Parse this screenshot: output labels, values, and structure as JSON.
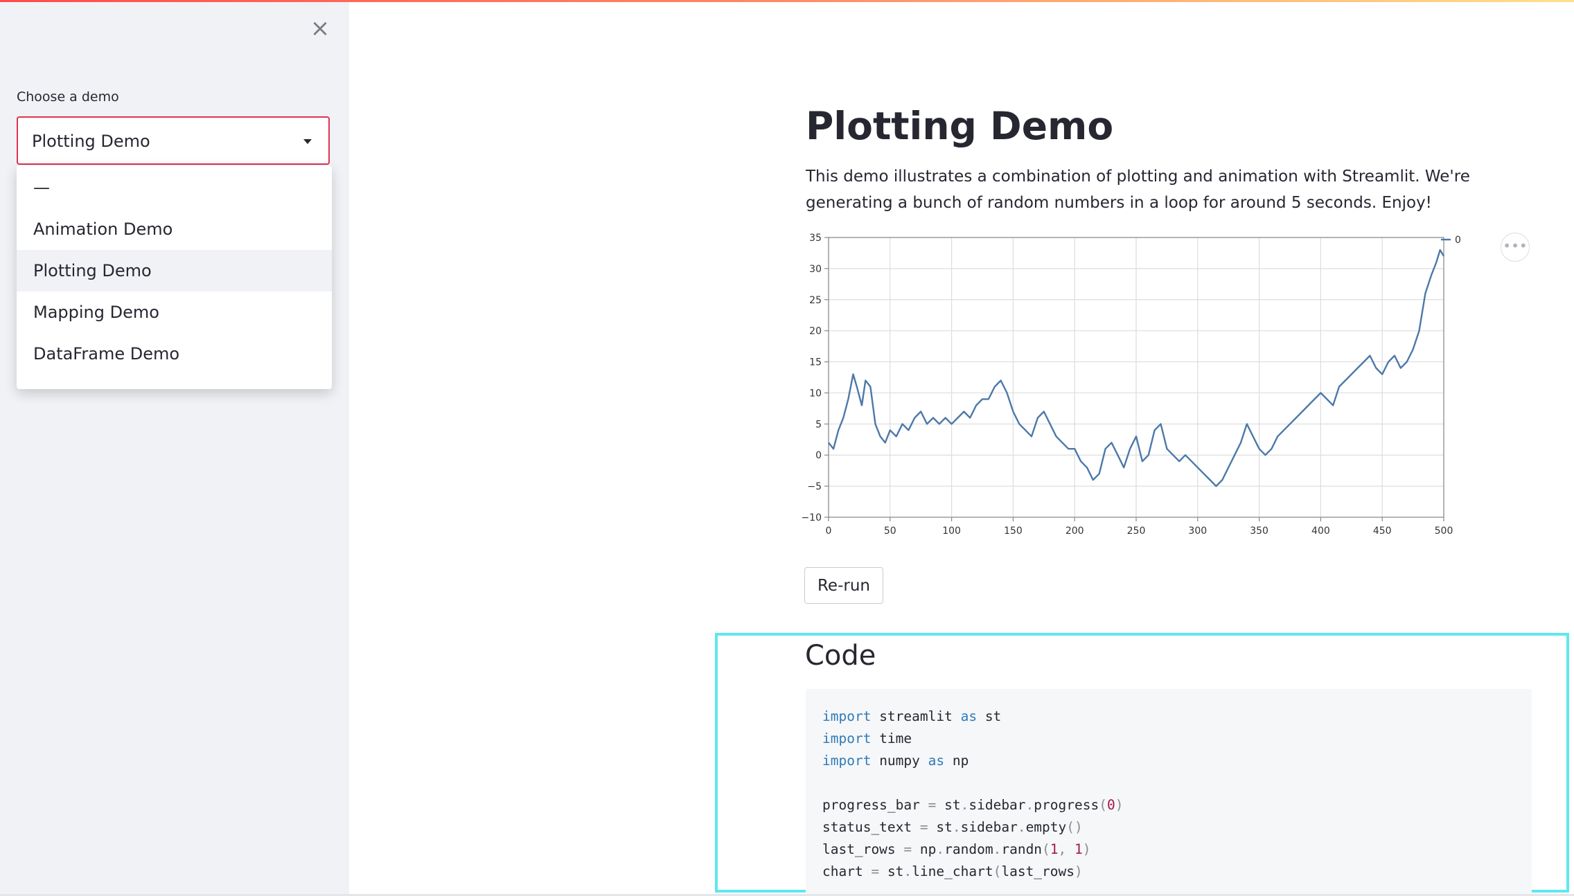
{
  "sidebar": {
    "close_symbol": "×",
    "select_label": "Choose a demo",
    "selected_value": "Plotting Demo",
    "options": [
      "—",
      "Animation Demo",
      "Plotting Demo",
      "Mapping Demo",
      "DataFrame Demo"
    ]
  },
  "main": {
    "title": "Plotting Demo",
    "description": "This demo illustrates a combination of plotting and animation with Streamlit. We're generating a bunch of random numbers in a loop for around 5 seconds. Enjoy!",
    "rerun_label": "Re-run",
    "more_menu_symbol": "•••",
    "code_heading": "Code",
    "code_lines": [
      [
        {
          "t": "import",
          "c": "kw"
        },
        {
          "t": " streamlit "
        },
        {
          "t": "as",
          "c": "kw"
        },
        {
          "t": " st"
        }
      ],
      [
        {
          "t": "import",
          "c": "kw"
        },
        {
          "t": " time"
        }
      ],
      [
        {
          "t": "import",
          "c": "kw"
        },
        {
          "t": " numpy "
        },
        {
          "t": "as",
          "c": "kw"
        },
        {
          "t": " np"
        }
      ],
      [],
      [
        {
          "t": "progress_bar "
        },
        {
          "t": "=",
          "c": "op"
        },
        {
          "t": " st"
        },
        {
          "t": ".",
          "c": "op"
        },
        {
          "t": "sidebar"
        },
        {
          "t": ".",
          "c": "op"
        },
        {
          "t": "progress"
        },
        {
          "t": "(",
          "c": "op"
        },
        {
          "t": "0",
          "c": "num"
        },
        {
          "t": ")",
          "c": "op"
        }
      ],
      [
        {
          "t": "status_text "
        },
        {
          "t": "=",
          "c": "op"
        },
        {
          "t": " st"
        },
        {
          "t": ".",
          "c": "op"
        },
        {
          "t": "sidebar"
        },
        {
          "t": ".",
          "c": "op"
        },
        {
          "t": "empty"
        },
        {
          "t": "()",
          "c": "op"
        }
      ],
      [
        {
          "t": "last_rows "
        },
        {
          "t": "=",
          "c": "op"
        },
        {
          "t": " np"
        },
        {
          "t": ".",
          "c": "op"
        },
        {
          "t": "random"
        },
        {
          "t": ".",
          "c": "op"
        },
        {
          "t": "randn"
        },
        {
          "t": "(",
          "c": "op"
        },
        {
          "t": "1",
          "c": "num"
        },
        {
          "t": ", ",
          "c": "op"
        },
        {
          "t": "1",
          "c": "num"
        },
        {
          "t": ")",
          "c": "op"
        }
      ],
      [
        {
          "t": "chart "
        },
        {
          "t": "=",
          "c": "op"
        },
        {
          "t": " st"
        },
        {
          "t": ".",
          "c": "op"
        },
        {
          "t": "line_chart"
        },
        {
          "t": "(",
          "c": "op"
        },
        {
          "t": "last_rows"
        },
        {
          "t": ")",
          "c": "op"
        }
      ]
    ]
  },
  "colors": {
    "accent_border": "#e0334f",
    "series_line": "#4c78a8",
    "highlight_frame": "#5ee8ee"
  },
  "chart_data": {
    "type": "line",
    "title": "",
    "xlabel": "",
    "ylabel": "",
    "xlim": [
      0,
      500
    ],
    "ylim": [
      -10,
      35
    ],
    "x_ticks": [
      0,
      50,
      100,
      150,
      200,
      250,
      300,
      350,
      400,
      450,
      500
    ],
    "y_ticks": [
      -10,
      -5,
      0,
      5,
      10,
      15,
      20,
      25,
      30,
      35
    ],
    "grid": true,
    "legend": "top-right",
    "series": [
      {
        "name": "0",
        "x": [
          0,
          4,
          8,
          12,
          16,
          20,
          23,
          27,
          30,
          34,
          38,
          42,
          46,
          50,
          55,
          60,
          65,
          70,
          75,
          80,
          85,
          90,
          95,
          100,
          105,
          110,
          115,
          120,
          125,
          130,
          135,
          140,
          145,
          150,
          155,
          160,
          165,
          170,
          175,
          180,
          185,
          190,
          195,
          200,
          205,
          210,
          215,
          220,
          225,
          230,
          235,
          240,
          245,
          250,
          255,
          260,
          265,
          270,
          275,
          280,
          285,
          290,
          295,
          300,
          305,
          310,
          315,
          320,
          325,
          330,
          335,
          340,
          345,
          350,
          355,
          360,
          365,
          370,
          375,
          380,
          385,
          390,
          395,
          400,
          405,
          410,
          415,
          420,
          425,
          430,
          435,
          440,
          445,
          450,
          455,
          460,
          465,
          470,
          475,
          480,
          485,
          490,
          494,
          497,
          500
        ],
        "y": [
          2,
          1,
          4,
          6,
          9,
          13,
          11,
          8,
          12,
          11,
          5,
          3,
          2,
          4,
          3,
          5,
          4,
          6,
          7,
          5,
          6,
          5,
          6,
          5,
          6,
          7,
          6,
          8,
          9,
          9,
          11,
          12,
          10,
          7,
          5,
          4,
          3,
          6,
          7,
          5,
          3,
          2,
          1,
          1,
          -1,
          -2,
          -4,
          -3,
          1,
          2,
          0,
          -2,
          1,
          3,
          -1,
          0,
          4,
          5,
          1,
          0,
          -1,
          0,
          -1,
          -2,
          -3,
          -4,
          -5,
          -4,
          -2,
          0,
          2,
          5,
          3,
          1,
          0,
          1,
          3,
          4,
          5,
          6,
          7,
          8,
          9,
          10,
          9,
          8,
          11,
          12,
          13,
          14,
          15,
          16,
          14,
          13,
          15,
          16,
          14,
          15,
          17,
          20,
          26,
          29,
          31,
          33,
          32
        ]
      }
    ]
  }
}
